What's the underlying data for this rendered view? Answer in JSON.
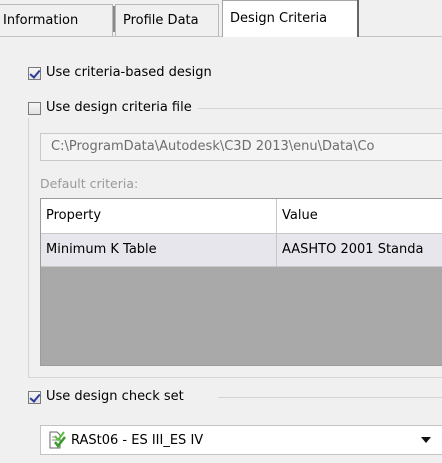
{
  "tabs": [
    {
      "label": "Information",
      "selected": false
    },
    {
      "label": "Profile Data",
      "selected": false
    },
    {
      "label": "Design Criteria",
      "selected": true
    }
  ],
  "criteria_based": {
    "label": "Use criteria-based design",
    "checked": true
  },
  "criteria_file": {
    "label": "Use design criteria file",
    "checked": false,
    "path": "C:\\ProgramData\\Autodesk\\C3D 2013\\enu\\Data\\Co",
    "default_label": "Default criteria:"
  },
  "table": {
    "columns": [
      "Property",
      "Value"
    ],
    "rows": [
      [
        "Minimum K Table",
        "AASHTO 2001 Standa"
      ]
    ]
  },
  "check_set": {
    "label": "Use design check set",
    "checked": true,
    "selected": "RASt06 - ES III_ES IV",
    "icon": "design-check-set-icon"
  },
  "colors": {
    "row_highlight": "#e6e6ec",
    "empty_grid": "#a9a9a9"
  }
}
